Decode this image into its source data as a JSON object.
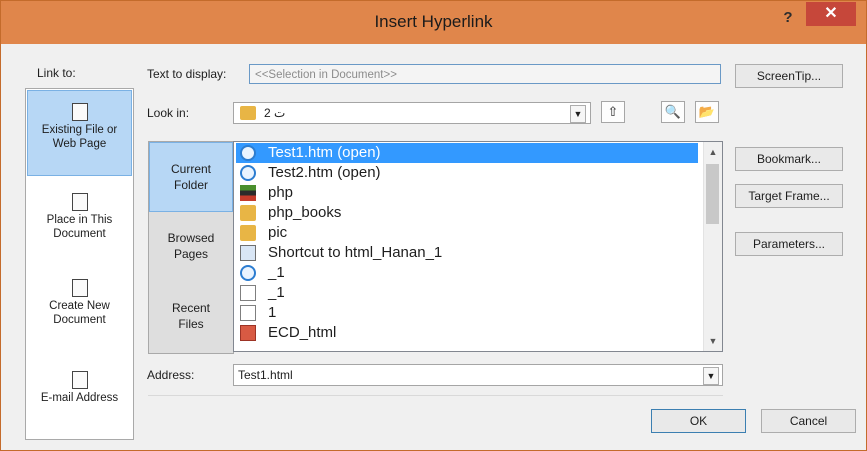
{
  "dialog": {
    "title": "Insert Hyperlink",
    "help_label": "?",
    "close_label": "✕"
  },
  "link_to": {
    "label": "Link to:",
    "items": [
      {
        "line1": "Existing File or",
        "line2": "Web Page",
        "selected": true
      },
      {
        "line1": "Place in This",
        "line2": "Document"
      },
      {
        "line1": "Create New",
        "line2": "Document"
      },
      {
        "line1": "E-mail Address",
        "line2": ""
      }
    ]
  },
  "text_to_display": {
    "label": "Text to display:",
    "value": "<<Selection in Document>>"
  },
  "look_in": {
    "label": "Look in:",
    "value": "ت 2",
    "dropdown_icon": "chevron-down-icon"
  },
  "nav": {
    "current_folder": {
      "line1": "Current",
      "line2": "Folder"
    },
    "browsed_pages": {
      "line1": "Browsed",
      "line2": "Pages"
    },
    "recent_files": {
      "line1": "Recent",
      "line2": "Files"
    }
  },
  "files": [
    {
      "name": "Test1.htm (open)",
      "icon": "ie-icon",
      "selected": true
    },
    {
      "name": "Test2.htm (open)",
      "icon": "ie-icon"
    },
    {
      "name": "php",
      "icon": "stack-icon"
    },
    {
      "name": "php_books",
      "icon": "folder-icon"
    },
    {
      "name": "pic",
      "icon": "folder-icon"
    },
    {
      "name": "Shortcut to html_Hanan_1",
      "icon": "shortcut-icon"
    },
    {
      "name": "_1",
      "icon": "ie-icon"
    },
    {
      "name": "_1",
      "icon": "document-icon"
    },
    {
      "name": "1",
      "icon": "document-icon"
    },
    {
      "name": "ECD_html",
      "icon": "pdf-icon"
    }
  ],
  "address": {
    "label": "Address:",
    "value": "Test1.html"
  },
  "buttons": {
    "screentip": "ScreenTip...",
    "bookmark": "Bookmark...",
    "target_frame": "Target Frame...",
    "parameters": "Parameters...",
    "ok": "OK",
    "cancel": "Cancel"
  },
  "colors": {
    "titlebar": "#e0864b",
    "close": "#c6473a",
    "selection": "#3399ff",
    "nav_selected": "#b7d7f5"
  }
}
